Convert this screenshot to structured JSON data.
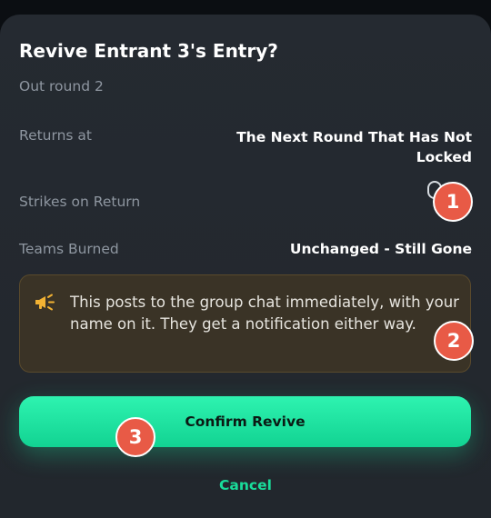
{
  "dialog": {
    "title": "Revive Entrant 3's Entry?",
    "subtitle": "Out round 2",
    "rows": [
      {
        "label": "Returns at",
        "value_line1": "The Next Round That Has Not",
        "value_line2": "Locked"
      },
      {
        "label": "Strikes on Return",
        "value": "0"
      },
      {
        "label": "Teams Burned",
        "value": "Unchanged - Still Gone"
      }
    ],
    "notice": {
      "icon": "megaphone-icon",
      "text": "This posts to the group chat immediately, with your name on it. They get a notification either way."
    },
    "confirm_label": "Confirm Revive",
    "cancel_label": "Cancel"
  },
  "annotations": [
    "1",
    "2",
    "3"
  ],
  "colors": {
    "accent": "#19dc9a",
    "background": "#22272d",
    "notice_bg": "#3a3326",
    "notice_icon": "#f2b233",
    "badge": "#e85a46"
  }
}
